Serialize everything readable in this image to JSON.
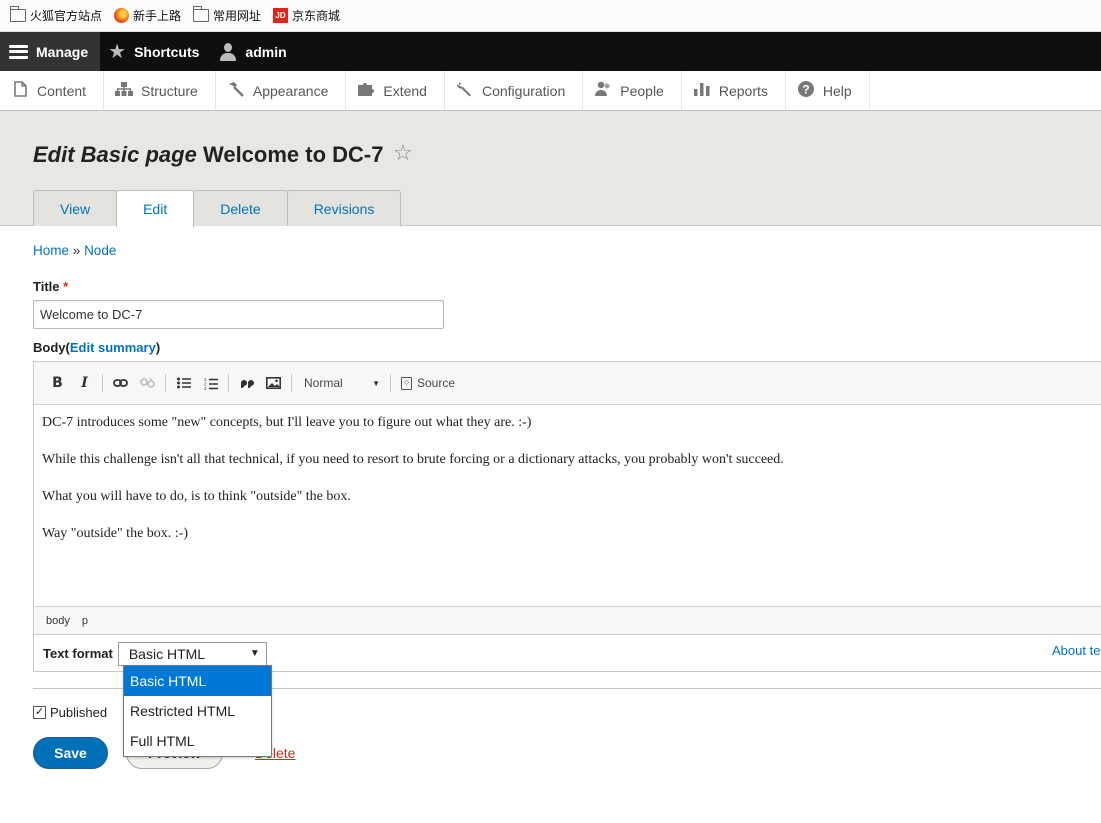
{
  "bookmarks": [
    {
      "icon": "folder-icon",
      "label": "火狐官方站点"
    },
    {
      "icon": "firefox-icon",
      "label": "新手上路"
    },
    {
      "icon": "folder-icon",
      "label": "常用网址"
    },
    {
      "icon": "jd-icon",
      "label": "京东商城",
      "icon_text": "JD"
    }
  ],
  "toolbar": {
    "manage": "Manage",
    "shortcuts": "Shortcuts",
    "user": "admin"
  },
  "tray": [
    {
      "icon": "content-icon",
      "label": "Content"
    },
    {
      "icon": "structure-icon",
      "label": "Structure"
    },
    {
      "icon": "appearance-icon",
      "label": "Appearance"
    },
    {
      "icon": "extend-icon",
      "label": "Extend"
    },
    {
      "icon": "configuration-icon",
      "label": "Configuration"
    },
    {
      "icon": "people-icon",
      "label": "People"
    },
    {
      "icon": "reports-icon",
      "label": "Reports"
    },
    {
      "icon": "help-icon",
      "label": "Help"
    }
  ],
  "header": {
    "title_prefix": "Edit Basic page",
    "title_name": "Welcome to DC-7",
    "tabs": [
      "View",
      "Edit",
      "Delete",
      "Revisions"
    ],
    "active_tab": "Edit"
  },
  "breadcrumb": {
    "home": "Home",
    "sep": "»",
    "node": "Node"
  },
  "form": {
    "title_label": "Title",
    "required_mark": "*",
    "title_value": "Welcome to DC-7",
    "body_label": "Body",
    "edit_summary": "Edit summary",
    "paragraph_format": "Normal",
    "source_label": "Source",
    "body_paragraphs": [
      "DC-7 introduces some \"new\" concepts, but I'll leave you to figure out what they are.  :-)",
      "While this challenge isn't all that technical, if you need to resort to brute forcing or a dictionary attacks, you probably won't succeed.",
      "What you will have to do, is to think \"outside\" the box.",
      "Way \"outside\" the box.  :-)"
    ],
    "element_path": [
      "body",
      "p"
    ],
    "text_format_label": "Text format",
    "text_format_value": "Basic HTML",
    "text_format_options": [
      "Basic HTML",
      "Restricted HTML",
      "Full HTML"
    ],
    "about_link": "About te",
    "published_label": "Published",
    "published_checked": true,
    "save": "Save",
    "preview": "Preview",
    "delete": "Delete"
  },
  "colors": {
    "link": "#0074bd",
    "primary_button": "#0071b8",
    "header_bg": "#e8e7e2",
    "toolbar_bg": "#0f0f0f",
    "dropdown_selected": "#0078d7",
    "delete_link": "#c4341a"
  }
}
